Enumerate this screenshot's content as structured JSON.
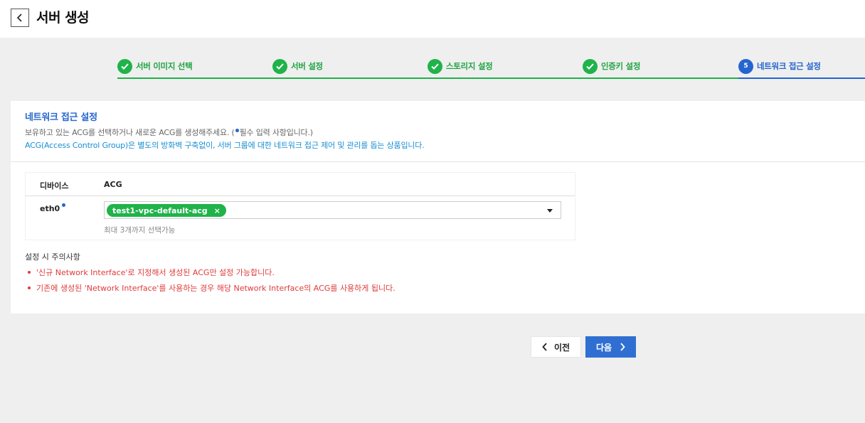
{
  "header": {
    "title": "서버 생성"
  },
  "stepper": {
    "steps": [
      {
        "label": "서버 이미지 선택",
        "status": "done"
      },
      {
        "label": "서버 설정",
        "status": "done"
      },
      {
        "label": "스토리지 설정",
        "status": "done"
      },
      {
        "label": "인증키 설정",
        "status": "done"
      },
      {
        "label": "네트워크 접근 설정",
        "status": "current",
        "number": "5"
      }
    ]
  },
  "section": {
    "title": "네트워크 접근 설정",
    "desc_before": "보유하고 있는 ACG를 선택하거나 새로운 ACG를 생성해주세요. (",
    "desc_after": "필수 입력 사항입니다.)",
    "desc2": "ACG(Access Control Group)은 별도의 방화벽 구축없이, 서버 그룹에 대한 네트워크 접근 제어 및 관리를 돕는 상품입니다."
  },
  "table": {
    "col_device": "디바이스",
    "col_acg": "ACG",
    "row": {
      "device": "eth0",
      "chip": "test1-vpc-default-acg",
      "chip_remove": "×"
    },
    "hint": "최대 3개까지 선택가능"
  },
  "notice": {
    "title": "설정 시 주의사항",
    "items": [
      "'신규 Network Interface'로 지정해서 생성된 ACG만 설정 가능합니다.",
      "기존에 생성된 'Network Interface'를 사용하는 경우 해당 Network Interface의 ACG를 사용하게 됩니다."
    ]
  },
  "buttons": {
    "prev": "이전",
    "next": "다음"
  },
  "colors": {
    "green": "#1fb34a",
    "blue": "#2565d0",
    "red": "#e03a3a"
  }
}
